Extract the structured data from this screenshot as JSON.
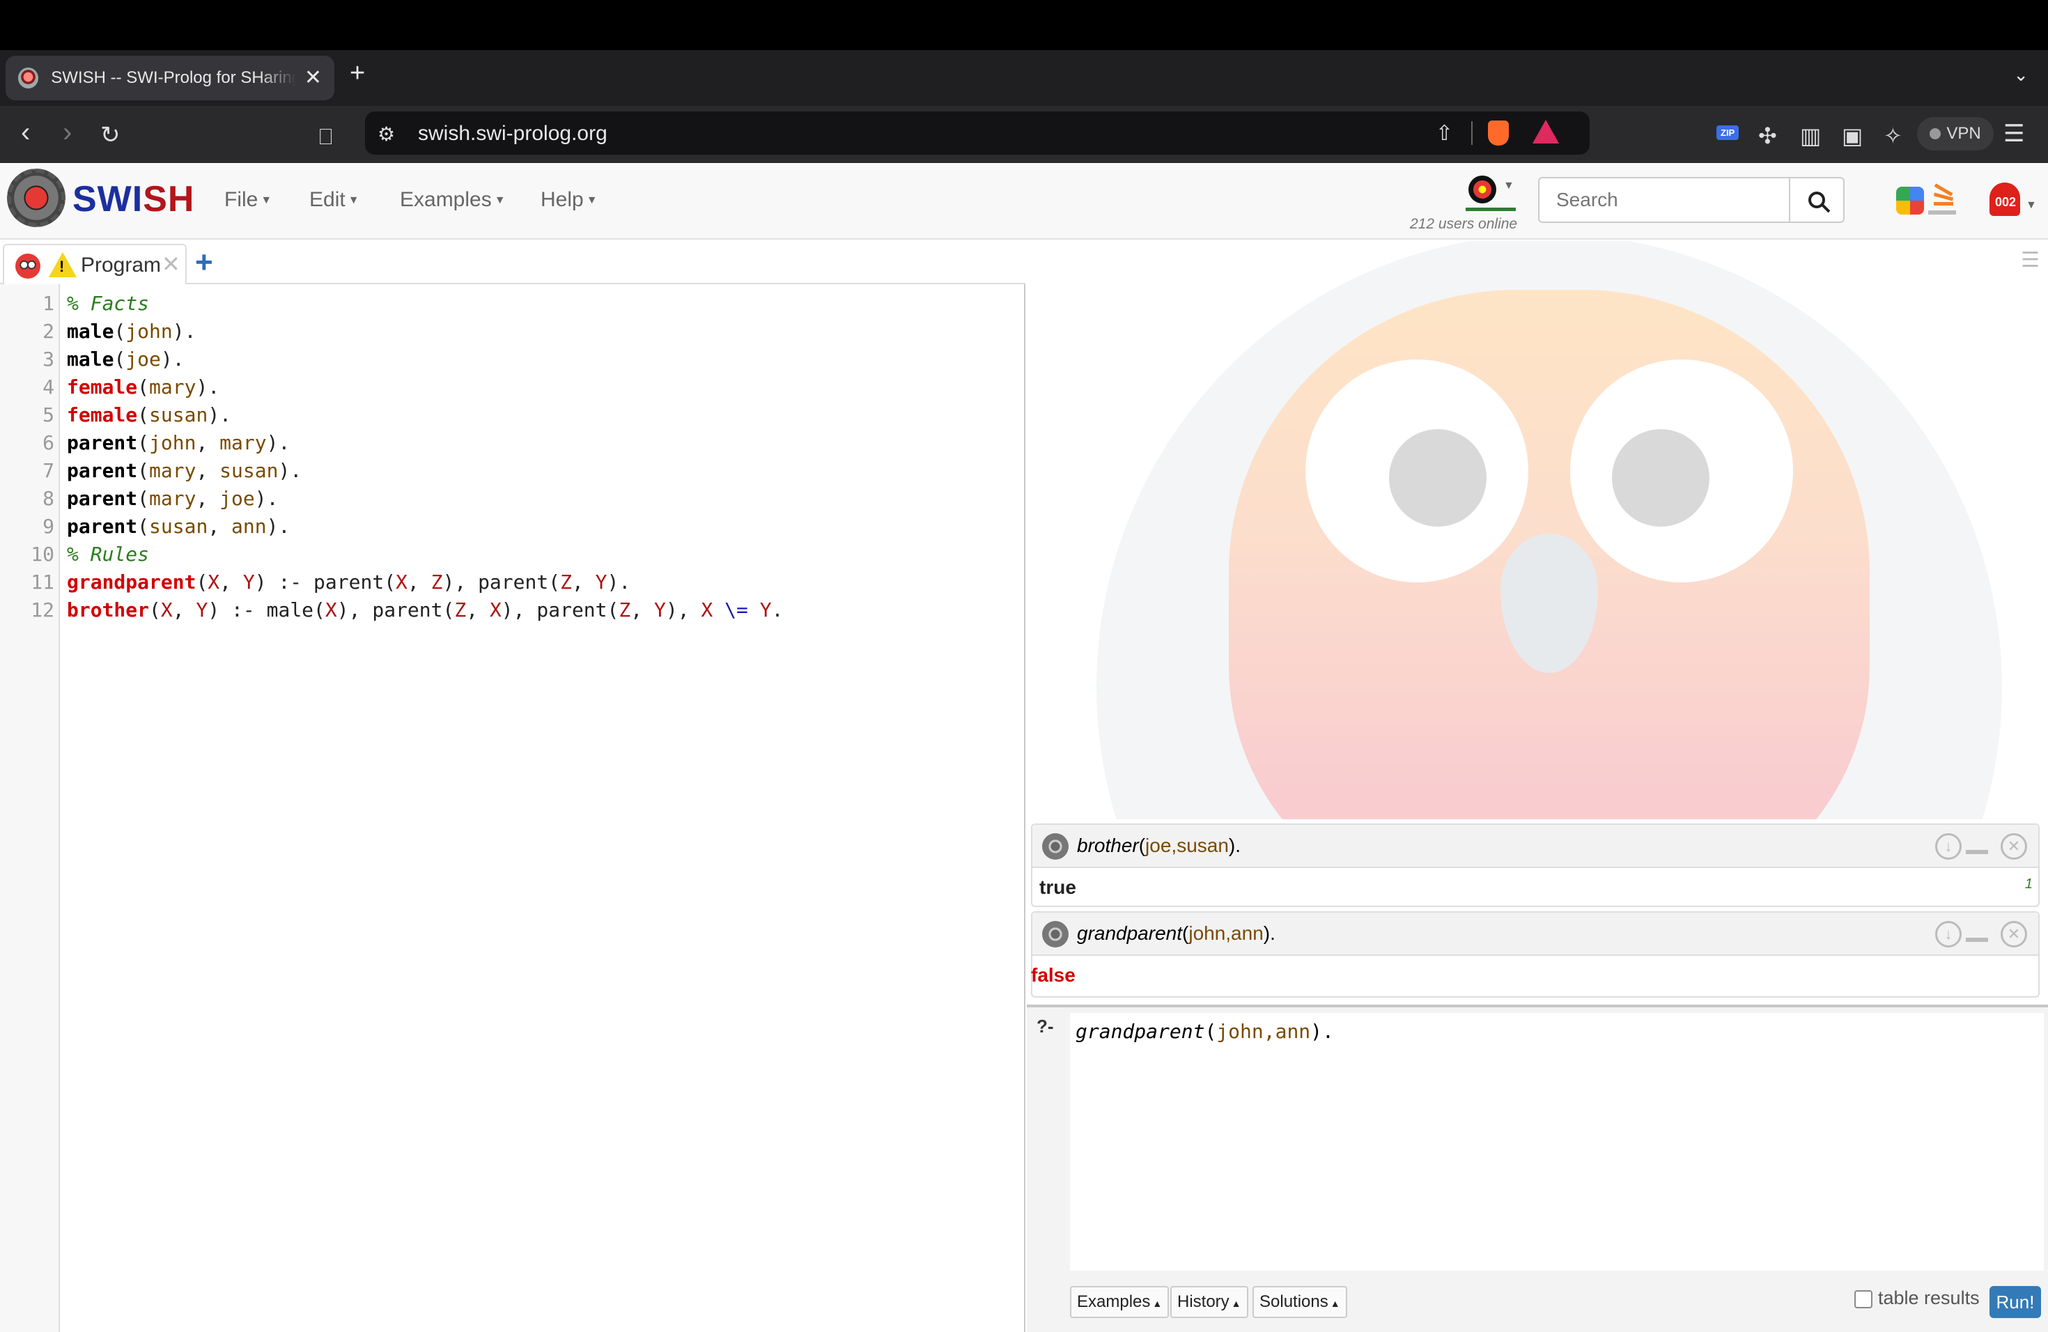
{
  "browser": {
    "tab_title": "SWISH -- SWI-Prolog for SHaring",
    "tab_close": "✕",
    "new_tab": "+",
    "url": "swish.swi-prolog.org",
    "vpn_label": "VPN",
    "zip_label": "ZIP"
  },
  "swish": {
    "brand_a": "SWI",
    "brand_b": "SH",
    "menus": [
      "File",
      "Edit",
      "Examples",
      "Help"
    ],
    "users_online": "212 users online",
    "search_placeholder": "Search",
    "notifications_badge": "002"
  },
  "editor": {
    "tab_label": "Program",
    "tab_close": "✕",
    "add_tab": "+",
    "line_numbers": [
      "1",
      "2",
      "3",
      "4",
      "5",
      "6",
      "7",
      "8",
      "9",
      "10",
      "11",
      "12"
    ],
    "lines": [
      "% Facts",
      "male(john).",
      "male(joe).",
      "female(mary).",
      "female(susan).",
      "parent(john, mary).",
      "parent(mary, susan).",
      "parent(mary, joe).",
      "parent(susan, ann).",
      "% Rules",
      "grandparent(X, Y) :- parent(X, Z), parent(Z, Y).",
      "brother(X, Y) :- male(X), parent(Z, X), parent(Z, Y), X \\= Y."
    ]
  },
  "answers": [
    {
      "pred": "brother",
      "args": "joe,susan",
      "result": "true",
      "count": "1"
    },
    {
      "pred": "grandparent",
      "args": "john,ann",
      "result": "false"
    }
  ],
  "query": {
    "prompt": "?-",
    "pred": "grandparent",
    "args": "john,ann",
    "buttons": [
      "Examples",
      "History",
      "Solutions"
    ],
    "table_results_label": "table results",
    "run_label": "Run!"
  },
  "colors": {
    "brand_blue": "#1c2f9e",
    "brand_red": "#b3151a",
    "run_button": "#337ab7",
    "false_red": "#d40000"
  }
}
